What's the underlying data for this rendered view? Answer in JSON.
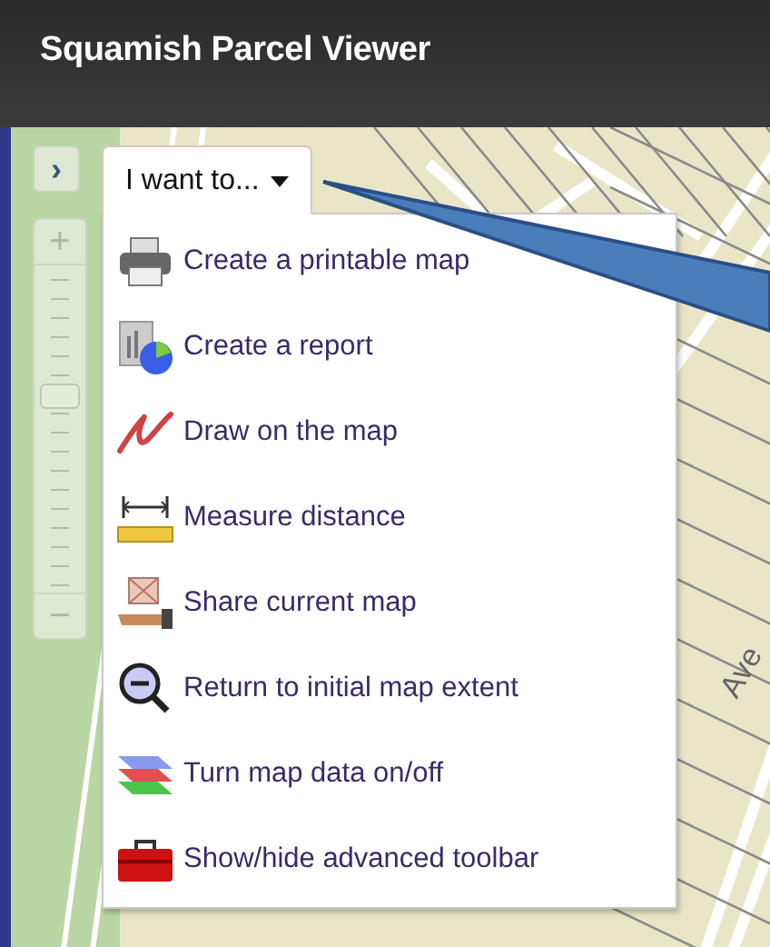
{
  "header": {
    "title": "Squamish Parcel Viewer"
  },
  "map": {
    "street_label": "Ave",
    "panel_toggle": "›",
    "zoom_in": "+",
    "zoom_out": "−",
    "zoom_slider": {
      "level": 0.6
    }
  },
  "menu": {
    "label": "I want to...",
    "expanded": true,
    "items": [
      {
        "kind": "print",
        "label": "Create a printable map"
      },
      {
        "kind": "report",
        "label": "Create a report"
      },
      {
        "kind": "draw",
        "label": "Draw on the map"
      },
      {
        "kind": "measure",
        "label": "Measure distance"
      },
      {
        "kind": "share",
        "label": "Share current map"
      },
      {
        "kind": "extent",
        "label": "Return to initial map extent"
      },
      {
        "kind": "layers",
        "label": "Turn map data on/off"
      },
      {
        "kind": "toolbox",
        "label": "Show/hide advanced toolbar"
      }
    ]
  }
}
